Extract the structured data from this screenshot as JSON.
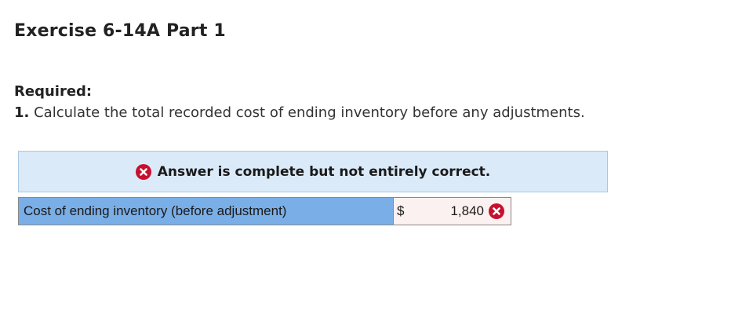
{
  "exercise": {
    "title": "Exercise 6-14A Part 1"
  },
  "required": {
    "heading": "Required:",
    "item_number": "1.",
    "item_text": "Calculate the total recorded cost of ending inventory before any adjustments."
  },
  "feedback": {
    "message": "Answer is complete but not entirely correct.",
    "icon": "incorrect-x-icon",
    "banner_color": "#dbeaf8"
  },
  "answer_table": {
    "row_label": "Cost of ending inventory (before adjustment)",
    "currency_symbol": "$",
    "value": "1,840",
    "status_icon": "incorrect-x-icon",
    "label_color": "#7aaee6",
    "cell_color": "#fbf1f0",
    "error_color": "#c8102e"
  }
}
